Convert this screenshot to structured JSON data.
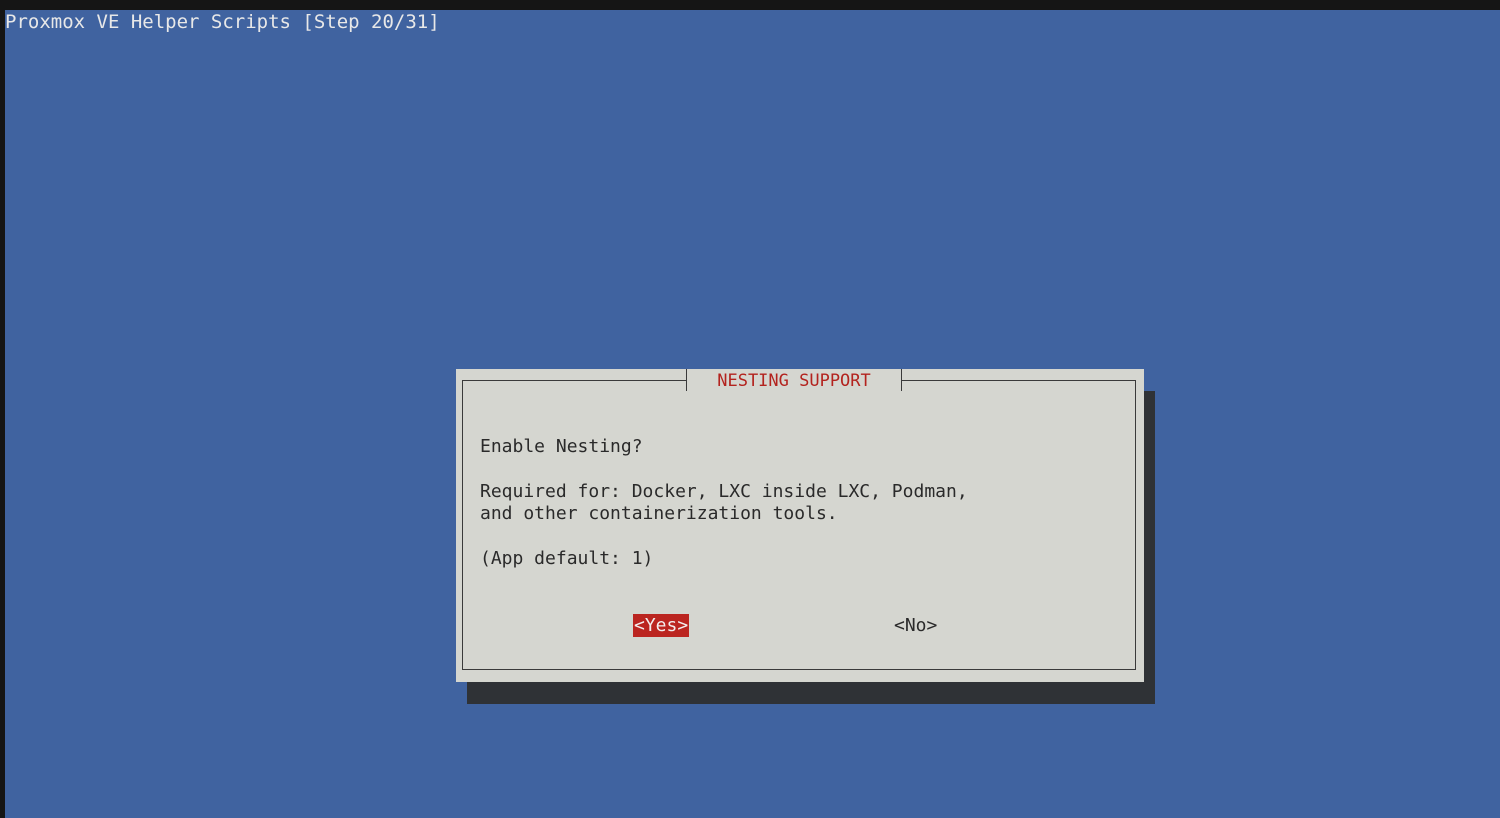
{
  "backtitle": "Proxmox VE Helper Scripts [Step 20/31]",
  "dialog": {
    "title": "NESTING SUPPORT",
    "lines": [
      "Enable Nesting?",
      "Required for: Docker, LXC inside LXC, Podman,",
      "and other containerization tools.",
      "(App default: 1)"
    ],
    "buttons": {
      "yes": "<Yes>",
      "no": "<No>"
    }
  },
  "colors": {
    "background": "#4063a0",
    "dialog": "#d5d6d0",
    "shadow": "#2f3236",
    "accent": "#bb2520",
    "title": "#b3231e"
  }
}
